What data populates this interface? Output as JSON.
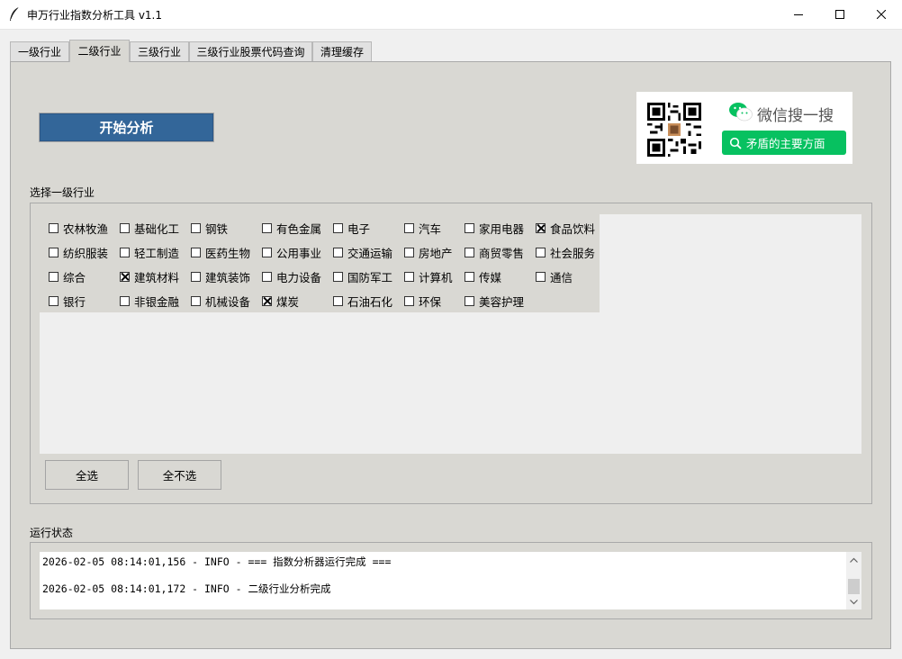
{
  "window": {
    "title": "申万行业指数分析工具 v1.1"
  },
  "tabs": [
    {
      "label": "一级行业",
      "active": false
    },
    {
      "label": "二级行业",
      "active": true
    },
    {
      "label": "三级行业",
      "active": false
    },
    {
      "label": "三级行业股票代码查询",
      "active": false
    },
    {
      "label": "清理缓存",
      "active": false
    }
  ],
  "start_button": {
    "label": "开始分析",
    "color": "#336699"
  },
  "banner": {
    "wechat_label": "微信搜一搜",
    "search_text": "矛盾的主要方面",
    "accent": "#07c160"
  },
  "industry_group": {
    "label": "选择一级行业",
    "items": [
      {
        "label": "农林牧渔",
        "checked": false
      },
      {
        "label": "基础化工",
        "checked": false
      },
      {
        "label": "钢铁",
        "checked": false
      },
      {
        "label": "有色金属",
        "checked": false
      },
      {
        "label": "电子",
        "checked": false
      },
      {
        "label": "汽车",
        "checked": false
      },
      {
        "label": "家用电器",
        "checked": false
      },
      {
        "label": "食品饮料",
        "checked": true
      },
      {
        "label": "纺织服装",
        "checked": false
      },
      {
        "label": "轻工制造",
        "checked": false
      },
      {
        "label": "医药生物",
        "checked": false
      },
      {
        "label": "公用事业",
        "checked": false
      },
      {
        "label": "交通运输",
        "checked": false
      },
      {
        "label": "房地产",
        "checked": false
      },
      {
        "label": "商贸零售",
        "checked": false
      },
      {
        "label": "社会服务",
        "checked": false
      },
      {
        "label": "综合",
        "checked": false
      },
      {
        "label": "建筑材料",
        "checked": true
      },
      {
        "label": "建筑装饰",
        "checked": false
      },
      {
        "label": "电力设备",
        "checked": false
      },
      {
        "label": "国防军工",
        "checked": false
      },
      {
        "label": "计算机",
        "checked": false
      },
      {
        "label": "传媒",
        "checked": false
      },
      {
        "label": "通信",
        "checked": false
      },
      {
        "label": "银行",
        "checked": false
      },
      {
        "label": "非银金融",
        "checked": false
      },
      {
        "label": "机械设备",
        "checked": false
      },
      {
        "label": "煤炭",
        "checked": true
      },
      {
        "label": "石油石化",
        "checked": false
      },
      {
        "label": "环保",
        "checked": false
      },
      {
        "label": "美容护理",
        "checked": false
      }
    ],
    "select_all_label": "全选",
    "deselect_all_label": "全不选"
  },
  "status_group": {
    "label": "运行状态",
    "log_lines": [
      "2026-02-05 08:14:01,156 - INFO - === 指数分析器运行完成 ===",
      "2026-02-05 08:14:01,172 - INFO - 二级行业分析完成"
    ]
  }
}
